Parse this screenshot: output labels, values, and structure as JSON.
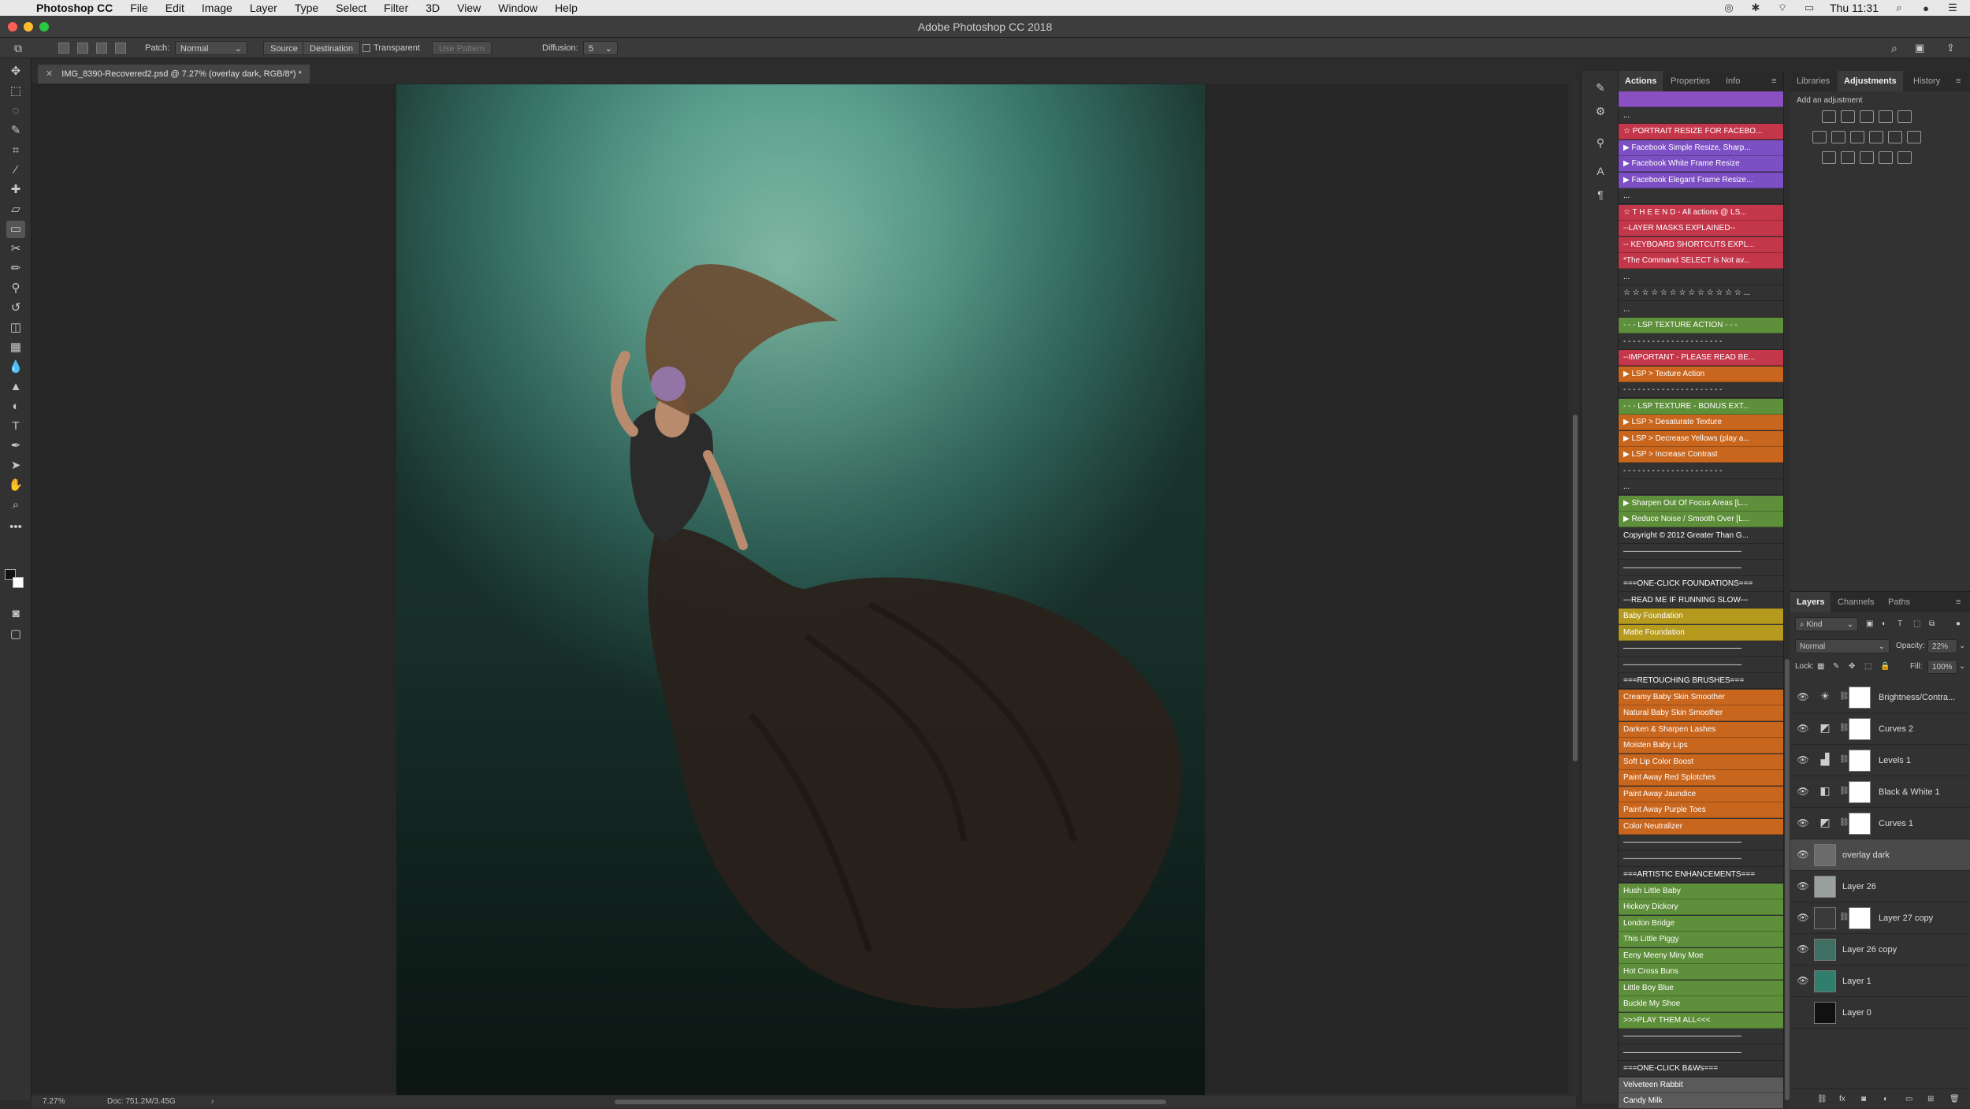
{
  "menubar": {
    "app_name": "Photoshop CC",
    "items": [
      "File",
      "Edit",
      "Image",
      "Layer",
      "Type",
      "Select",
      "Filter",
      "3D",
      "View",
      "Window",
      "Help"
    ],
    "clock": "Thu 11:31"
  },
  "window": {
    "title": "Adobe Photoshop CC 2018"
  },
  "options_bar": {
    "patch_label": "Patch:",
    "patch_mode": "Normal",
    "source_label": "Source",
    "destination_label": "Destination",
    "transparent_label": "Transparent",
    "use_pattern_label": "Use Pattern",
    "diffusion_label": "Diffusion:",
    "diffusion_value": "5"
  },
  "document": {
    "tab_title": "IMG_8390-Recovered2.psd @ 7.27% (overlay dark, RGB/8*) *",
    "zoom": "7.27%",
    "doc_size": "Doc: 751.2M/3.45G"
  },
  "actions_panel": {
    "tabs": [
      "Actions",
      "Properties",
      "Info"
    ],
    "rows": [
      {
        "label": "",
        "color": "#8a4fc0"
      },
      {
        "label": "...",
        "color": "#323232"
      },
      {
        "label": "☆ PORTRAIT RESIZE FOR FACEBO...",
        "color": "#c4364a"
      },
      {
        "label": "▶ Facebook Simple Resize, Sharp...",
        "color": "#7d4fc4"
      },
      {
        "label": "▶ Facebook White Frame Resize",
        "color": "#7d4fc4"
      },
      {
        "label": "▶ Facebook Elegant Frame Resize...",
        "color": "#7d4fc4"
      },
      {
        "label": "...",
        "color": "#323232"
      },
      {
        "label": "☆ T H E  E N D - All actions @ LS...",
        "color": "#c4364a"
      },
      {
        "label": "--LAYER MASKS EXPLAINED--",
        "color": "#c4364a"
      },
      {
        "label": "-- KEYBOARD SHORTCUTS EXPL...",
        "color": "#c4364a"
      },
      {
        "label": "*The Command SELECT is Not av...",
        "color": "#c4364a"
      },
      {
        "label": "...",
        "color": "#323232"
      },
      {
        "label": "☆ ☆ ☆ ☆ ☆ ☆ ☆ ☆ ☆ ☆ ☆ ☆ ☆ ...",
        "color": "#323232"
      },
      {
        "label": "...",
        "color": "#323232"
      },
      {
        "label": "- - - LSP TEXTURE ACTION - - -",
        "color": "#5e8f3a"
      },
      {
        "label": "- - - - - - - - - - - - - - - - - - - - -",
        "color": "#323232"
      },
      {
        "label": "--IMPORTANT - PLEASE READ BE...",
        "color": "#c4364a"
      },
      {
        "label": "▶ LSP > Texture Action",
        "color": "#c9661e"
      },
      {
        "label": "- - - - - - - - - - - - - - - - - - - - -",
        "color": "#323232"
      },
      {
        "label": "- - - LSP TEXTURE - BONUS EXT...",
        "color": "#5e8f3a"
      },
      {
        "label": "▶ LSP > Desaturate Texture",
        "color": "#c9661e"
      },
      {
        "label": "▶ LSP > Decrease Yellows (play a...",
        "color": "#c9661e"
      },
      {
        "label": "▶ LSP > Increase Contrast",
        "color": "#c9661e"
      },
      {
        "label": "- - - - - - - - - - - - - - - - - - - - -",
        "color": "#323232"
      },
      {
        "label": "...",
        "color": "#323232"
      },
      {
        "label": "▶ Sharpen Out Of Focus Areas [L...",
        "color": "#5e8f3a"
      },
      {
        "label": "▶ Reduce Noise / Smooth Over [L...",
        "color": "#5e8f3a"
      },
      {
        "label": "Copyright © 2012 Greater Than G...",
        "color": "#323232"
      },
      {
        "label": "———————————————",
        "color": "#323232"
      },
      {
        "label": "———————————————",
        "color": "#323232"
      },
      {
        "label": "===ONE-CLICK FOUNDATIONS===",
        "color": "#323232"
      },
      {
        "label": "---READ ME IF RUNNING SLOW---",
        "color": "#323232"
      },
      {
        "label": "Baby Foundation",
        "color": "#b59a1e"
      },
      {
        "label": "Matte Foundation",
        "color": "#b59a1e"
      },
      {
        "label": "———————————————",
        "color": "#323232"
      },
      {
        "label": "———————————————",
        "color": "#323232"
      },
      {
        "label": "===RETOUCHING BRUSHES===",
        "color": "#323232"
      },
      {
        "label": "Creamy Baby Skin Smoother",
        "color": "#c9661e"
      },
      {
        "label": "Natural Baby Skin Smoother",
        "color": "#c9661e"
      },
      {
        "label": "Darken & Sharpen Lashes",
        "color": "#c9661e"
      },
      {
        "label": "Moisten Baby Lips",
        "color": "#c9661e"
      },
      {
        "label": "Soft Lip Color Boost",
        "color": "#c9661e"
      },
      {
        "label": "Paint Away Red Splotches",
        "color": "#c9661e"
      },
      {
        "label": "Paint Away Jaundice",
        "color": "#c9661e"
      },
      {
        "label": "Paint Away Purple Toes",
        "color": "#c9661e"
      },
      {
        "label": "Color Neutralizer",
        "color": "#c9661e"
      },
      {
        "label": "———————————————",
        "color": "#323232"
      },
      {
        "label": "———————————————",
        "color": "#323232"
      },
      {
        "label": "===ARTISTIC ENHANCEMENTS===",
        "color": "#323232"
      },
      {
        "label": "Hush Little Baby",
        "color": "#5e8f3a"
      },
      {
        "label": "Hickory Dickory",
        "color": "#5e8f3a"
      },
      {
        "label": "London Bridge",
        "color": "#5e8f3a"
      },
      {
        "label": "This Little Piggy",
        "color": "#5e8f3a"
      },
      {
        "label": "Eeny Meeny Miny Moe",
        "color": "#5e8f3a"
      },
      {
        "label": "Hot Cross Buns",
        "color": "#5e8f3a"
      },
      {
        "label": "Little Boy Blue",
        "color": "#5e8f3a"
      },
      {
        "label": "Buckle My Shoe",
        "color": "#5e8f3a"
      },
      {
        "label": ">>>PLAY THEM ALL<<<",
        "color": "#5e8f3a"
      },
      {
        "label": "———————————————",
        "color": "#323232"
      },
      {
        "label": "———————————————",
        "color": "#323232"
      },
      {
        "label": "===ONE-CLICK B&Ws===",
        "color": "#323232"
      },
      {
        "label": "Velveteen Rabbit",
        "color": "#5a5a5a"
      },
      {
        "label": "Candy Milk",
        "color": "#5a5a5a"
      }
    ]
  },
  "adjustments_panel": {
    "tabs": [
      "Libraries",
      "Adjustments",
      "History"
    ],
    "hint": "Add an adjustment"
  },
  "layers_panel": {
    "tabs": [
      "Layers",
      "Channels",
      "Paths"
    ],
    "kind_label": "Kind",
    "blend_mode": "Normal",
    "opacity_label": "Opacity:",
    "opacity_value": "22%",
    "lock_label": "Lock:",
    "fill_label": "Fill:",
    "fill_value": "100%",
    "layers": [
      {
        "name": "Brightness/Contra...",
        "kind": "adjustment",
        "glyph": "☀",
        "visible": true,
        "selected": false
      },
      {
        "name": "Curves 2",
        "kind": "adjustment",
        "glyph": "◩",
        "visible": true,
        "selected": false
      },
      {
        "name": "Levels 1",
        "kind": "adjustment",
        "glyph": "▟",
        "visible": true,
        "selected": false
      },
      {
        "name": "Black & White 1",
        "kind": "adjustment",
        "glyph": "◧",
        "visible": true,
        "selected": false
      },
      {
        "name": "Curves 1",
        "kind": "adjustment",
        "glyph": "◩",
        "visible": true,
        "selected": false
      },
      {
        "name": "overlay dark",
        "kind": "pixel",
        "thumb_color": "#6b6b6b",
        "visible": true,
        "selected": true
      },
      {
        "name": "Layer 26",
        "kind": "pixel",
        "thumb_color": "#9aa0a0",
        "visible": true,
        "selected": false
      },
      {
        "name": "Layer 27 copy",
        "kind": "masked",
        "thumb_color": "#3a3a3a",
        "visible": true,
        "selected": false
      },
      {
        "name": "Layer 26 copy",
        "kind": "pixel",
        "thumb_color": "#3f6e62",
        "visible": true,
        "selected": false
      },
      {
        "name": "Layer 1",
        "kind": "pixel",
        "thumb_color": "#2f7f6c",
        "visible": true,
        "selected": false
      },
      {
        "name": "Layer 0",
        "kind": "pixel",
        "thumb_color": "#111111",
        "visible": false,
        "selected": false
      }
    ]
  }
}
